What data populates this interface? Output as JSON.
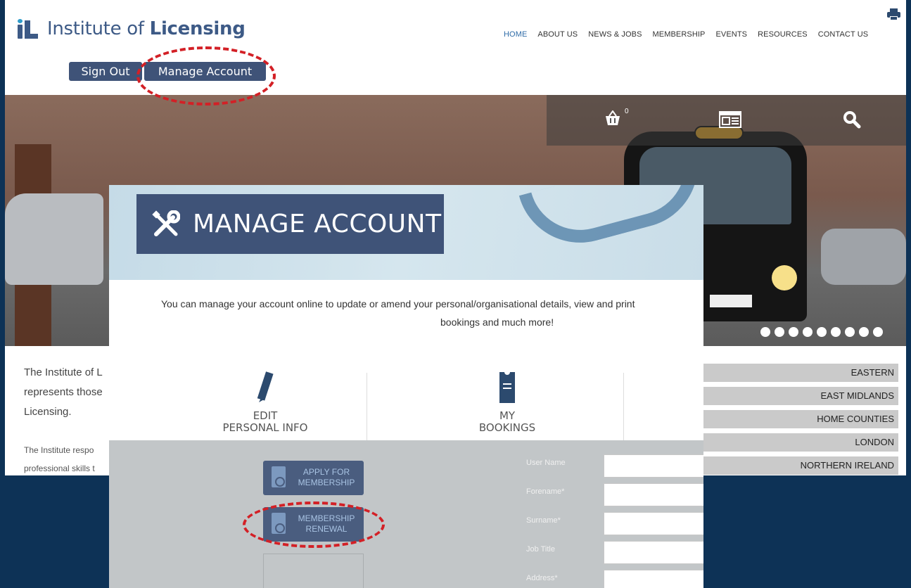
{
  "site": {
    "logo_text_light": "Institute of ",
    "logo_text_bold": "Licensing"
  },
  "nav": {
    "items": [
      "HOME",
      "ABOUT US",
      "NEWS & JOBS",
      "MEMBERSHIP",
      "EVENTS",
      "RESOURCES",
      "CONTACT US"
    ],
    "active": "HOME"
  },
  "account_buttons": {
    "sign_out": "Sign Out",
    "manage_account": "Manage Account"
  },
  "hero": {
    "basket_count": "0",
    "carousel_dots": 9
  },
  "intro": {
    "line1": "The Institute of L",
    "line2": "represents those",
    "line3": "Licensing.",
    "para2_line1": "The Institute respo",
    "para2_line2": "professional skills t"
  },
  "regions": [
    "EASTERN",
    "EAST MIDLANDS",
    "HOME COUNTIES",
    "LONDON",
    "NORTHERN IRELAND"
  ],
  "manage_account": {
    "title": "MANAGE ACCOUNT",
    "description_line1": "You can manage your account online to update or amend your personal/organisational details, view and print",
    "description_line2": "bookings and much more!",
    "tile_edit_line1": "EDIT",
    "tile_edit_line2": "PERSONAL INFO",
    "tile_bookings_line1": "MY",
    "tile_bookings_line2": "BOOKINGS",
    "btn_apply_line1": "APPLY FOR",
    "btn_apply_line2": "MEMBERSHIP",
    "btn_renew_line1": "MEMBERSHIP",
    "btn_renew_line2": "RENEWAL",
    "form_labels": [
      "User Name",
      "Forename*",
      "Surname*",
      "Job Title",
      "Address*"
    ]
  },
  "colors": {
    "background": "#0d3256",
    "button": "#3f5378",
    "highlight": "#d32026",
    "nav_active": "#2f6ca8"
  },
  "icons": [
    "print-icon",
    "basket-icon",
    "newspaper-icon",
    "search-icon",
    "wrench-screwdriver-icon",
    "pencil-icon",
    "ticket-icon",
    "document-icon"
  ]
}
